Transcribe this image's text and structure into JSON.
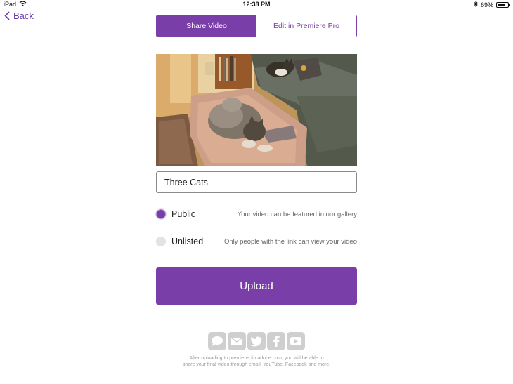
{
  "status_bar": {
    "device": "iPad",
    "time": "12:38 PM",
    "battery_percent": "69%",
    "battery_level": 0.69,
    "icons": [
      "wifi-icon",
      "bluetooth-icon",
      "battery-icon"
    ]
  },
  "nav": {
    "back_label": "Back"
  },
  "tabs": [
    {
      "label": "Share Video",
      "active": true
    },
    {
      "label": "Edit in Premiere Pro",
      "active": false
    }
  ],
  "video": {
    "title_value": "Three Cats"
  },
  "visibility": {
    "selected": "Public",
    "options": [
      {
        "label": "Public",
        "description": "Your video can be featured in our gallery"
      },
      {
        "label": "Unlisted",
        "description": "Only people with the link can view your video"
      }
    ]
  },
  "upload_label": "Upload",
  "share": {
    "icons": [
      "message-icon",
      "mail-icon",
      "twitter-icon",
      "facebook-icon",
      "youtube-icon"
    ],
    "note_line1": "After uploading to premiereclip.adobe.com, you will be able to",
    "note_line2": "share your final video through email, YouTube, Facebook and more."
  },
  "colors": {
    "accent": "#7a3ea8",
    "icon_gray": "#cfcfcf"
  }
}
